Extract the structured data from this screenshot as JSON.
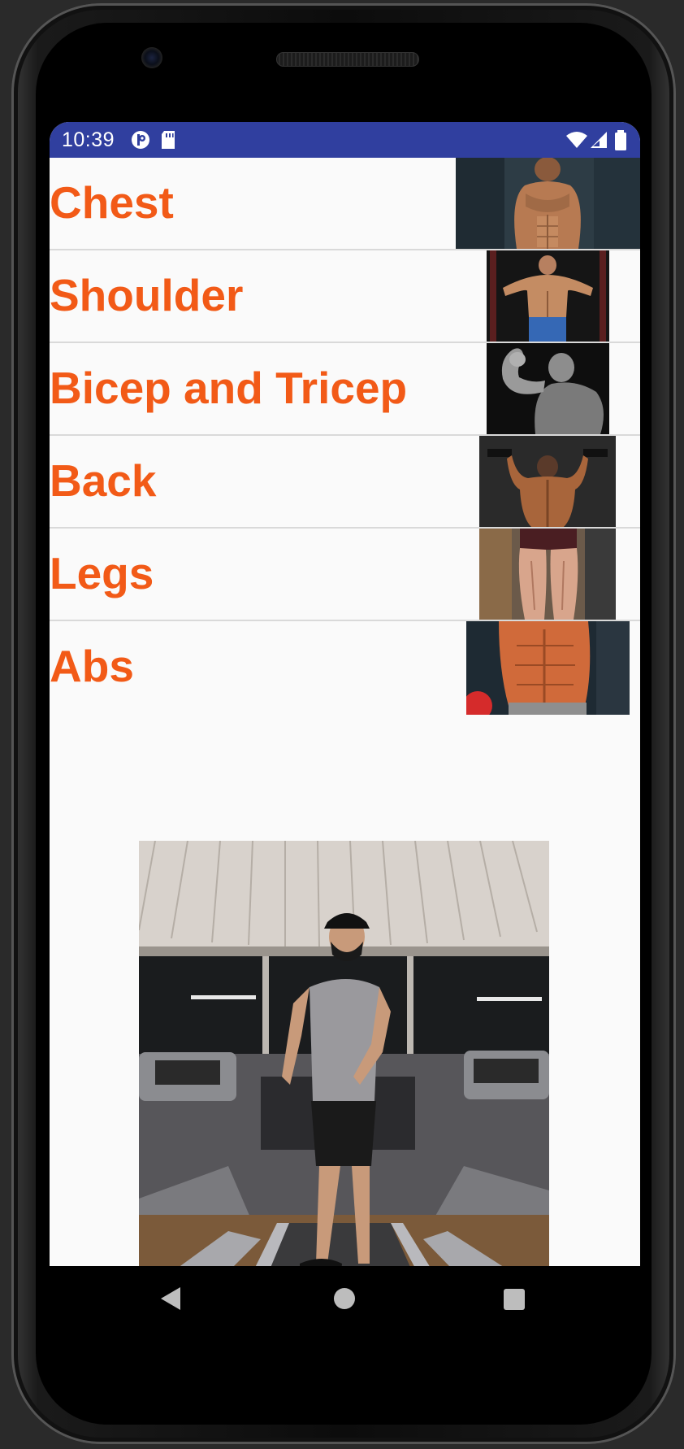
{
  "status_bar": {
    "time": "10:39",
    "left_icons": [
      "app-notification-icon",
      "sd-card-icon"
    ],
    "right_icons": [
      "wifi-icon",
      "cell-signal-icon",
      "battery-icon"
    ],
    "background_color": "#303f9f"
  },
  "workouts": [
    {
      "label": "Chest",
      "image": "chest-workout-image"
    },
    {
      "label": "Shoulder",
      "image": "shoulder-workout-image"
    },
    {
      "label": "Bicep and Tricep",
      "image": "bicep-tricep-workout-image"
    },
    {
      "label": "Back",
      "image": "back-workout-image"
    },
    {
      "label": "Legs",
      "image": "legs-workout-image"
    },
    {
      "label": "Abs",
      "image": "abs-workout-image"
    }
  ],
  "label_color": "#f25a17",
  "gym_photo": {
    "image": "gym-treadmill-photo"
  },
  "nav_bar": {
    "buttons": [
      "back-icon",
      "home-icon",
      "recents-icon"
    ]
  }
}
